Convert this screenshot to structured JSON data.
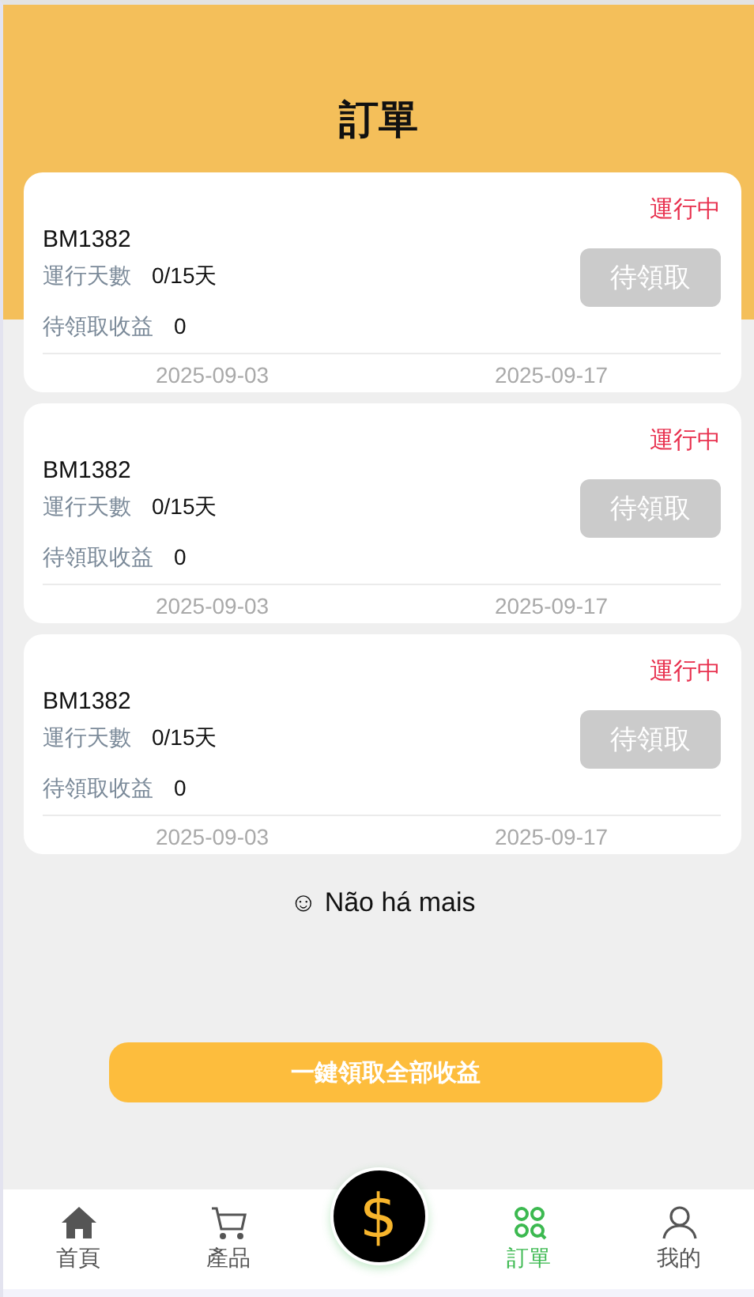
{
  "header": {
    "title": "訂單"
  },
  "orders": [
    {
      "code": "BM1382",
      "status": "運行中",
      "days_label": "運行天數",
      "days": "0/15天",
      "earn_label": "待領取收益",
      "earn": "0",
      "button": {
        "label": "待領取",
        "disabled": true
      },
      "start": "2025-09-03",
      "end": "2025-09-17"
    },
    {
      "code": "BM1382",
      "status": "運行中",
      "days_label": "運行天數",
      "days": "0/15天",
      "earn_label": "待領取收益",
      "earn": "0",
      "button": {
        "label": "待領取",
        "disabled": true
      },
      "start": "2025-09-03",
      "end": "2025-09-17"
    },
    {
      "code": "BM1382",
      "status": "運行中",
      "days_label": "運行天數",
      "days": "0/15天",
      "earn_label": "待領取收益",
      "earn": "0",
      "button": {
        "label": "待領取",
        "disabled": true
      },
      "start": "2025-09-03",
      "end": "2025-09-17"
    }
  ],
  "end_note": "☺ Não há mais",
  "claim_all_button": "一鍵領取全部收益",
  "nav": [
    {
      "kind": "home",
      "label": "首頁",
      "selected": false
    },
    {
      "kind": "cart",
      "label": "產品",
      "selected": false
    },
    {
      "kind": "center",
      "label": "$"
    },
    {
      "kind": "orders",
      "label": "訂單",
      "selected": true
    },
    {
      "kind": "profile",
      "label": "我的",
      "selected": false
    }
  ]
}
